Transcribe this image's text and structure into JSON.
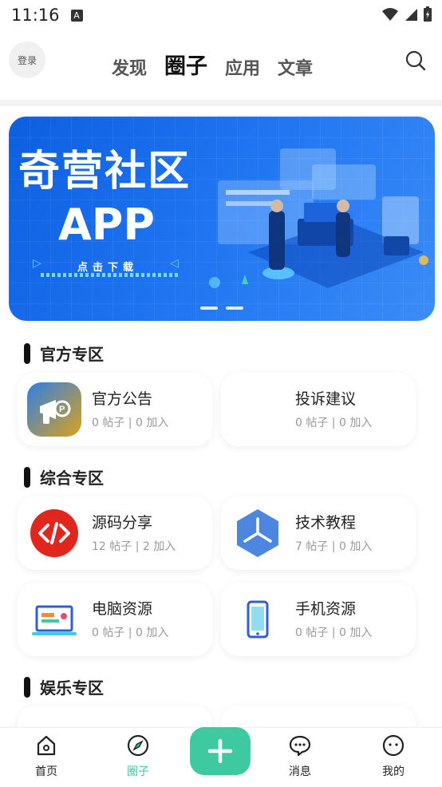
{
  "status_bar": {
    "time": "11:16",
    "notif_glyph": "A"
  },
  "header": {
    "login_label": "登录",
    "tabs": [
      {
        "label": "发现"
      },
      {
        "label": "圈子"
      },
      {
        "label": "应用"
      },
      {
        "label": "文章"
      }
    ],
    "active_tab": "圈子"
  },
  "banner": {
    "title": "奇营社区",
    "subtitle": "APP",
    "cta": "点击下载",
    "slide_count": 2
  },
  "sections": [
    {
      "title": "官方专区",
      "items": [
        {
          "name": "官方公告",
          "posts": "0 帖子",
          "joins": "0 加入",
          "icon": "megaphone-icon"
        },
        {
          "name": "投诉建议",
          "posts": "0 帖子",
          "joins": "0 加入",
          "icon": ""
        }
      ]
    },
    {
      "title": "综合专区",
      "items": [
        {
          "name": "源码分享",
          "posts": "12 帖子",
          "joins": "2 加入",
          "icon": "code-icon"
        },
        {
          "name": "技术教程",
          "posts": "7 帖子",
          "joins": "0 加入",
          "icon": "hexagon-icon"
        },
        {
          "name": "电脑资源",
          "posts": "0 帖子",
          "joins": "0 加入",
          "icon": "laptop-icon"
        },
        {
          "name": "手机资源",
          "posts": "0 帖子",
          "joins": "0 加入",
          "icon": "phone-icon"
        }
      ]
    },
    {
      "title": "娱乐专区",
      "items": []
    }
  ],
  "tabbar": {
    "items": [
      {
        "label": "首页",
        "icon": "home-icon"
      },
      {
        "label": "圈子",
        "icon": "compass-icon"
      },
      {
        "label": "消息",
        "icon": "chat-icon"
      },
      {
        "label": "我的",
        "icon": "face-icon"
      }
    ],
    "active": "圈子"
  },
  "colors": {
    "accent": "#3ec9a0",
    "banner": "#1e73f0",
    "code_red": "#e0261d",
    "hex_blue": "#4d86e0"
  }
}
